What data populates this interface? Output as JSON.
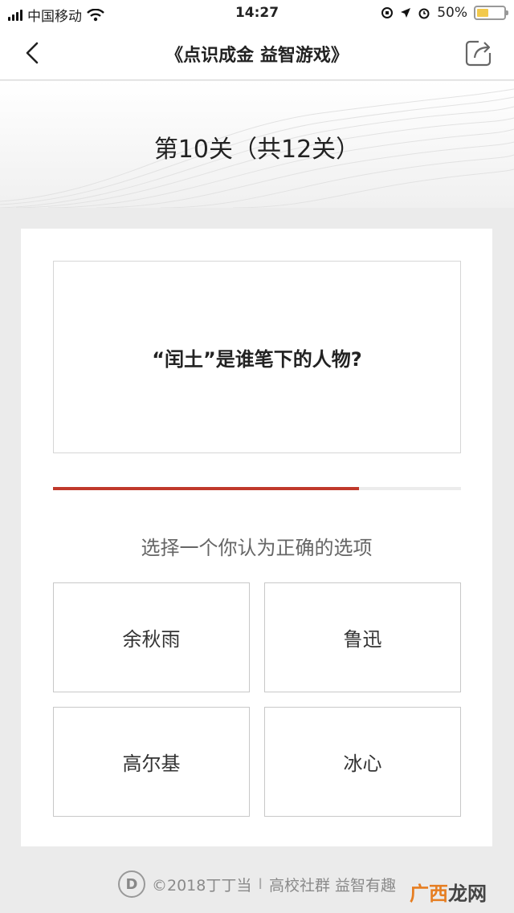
{
  "status_bar": {
    "carrier": "中国移动",
    "time": "14:27",
    "battery": "50%",
    "battery_level": 0.5
  },
  "nav": {
    "title": "《点识成金 益智游戏》",
    "back_icon": "chevron-left-icon",
    "share_icon": "share-icon"
  },
  "level": {
    "title": "第10关（共12关）"
  },
  "question": {
    "text": "“闰土”是谁笔下的人物?",
    "progress": 0.75
  },
  "prompt": "选择一个你认为正确的选项",
  "options": [
    {
      "label": "余秋雨"
    },
    {
      "label": "鲁迅"
    },
    {
      "label": "高尔基"
    },
    {
      "label": "冰心"
    }
  ],
  "footer": {
    "logo_text": "D",
    "copyright": "©2018丁丁当",
    "separator": "I",
    "slogan": "高校社群 益智有趣"
  },
  "watermark": {
    "part1": "广西",
    "part2": "龙网"
  },
  "colors": {
    "accent": "#c0392b",
    "background": "#ebebeb",
    "battery": "#f2c94c"
  }
}
